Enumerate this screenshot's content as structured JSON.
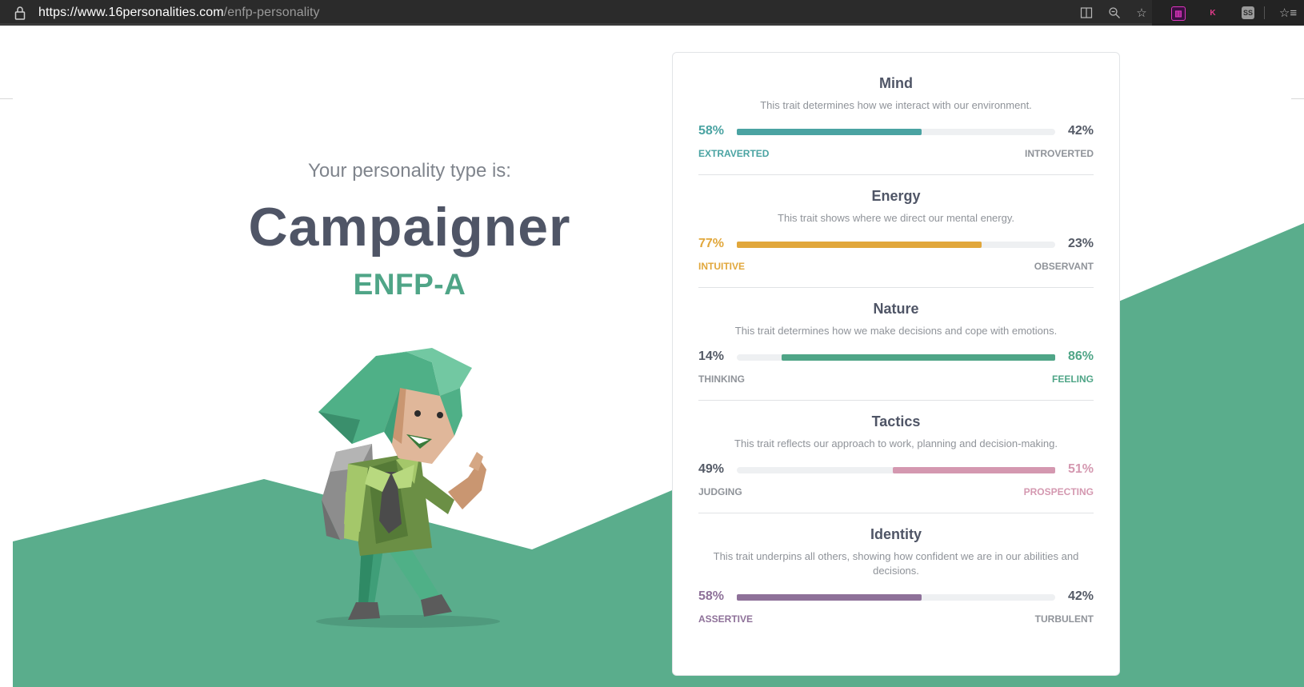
{
  "browser": {
    "url_domain": "https://www.16personalities.com",
    "url_path": "/enfp-personality",
    "icons": [
      "lock-icon",
      "reader-mode-icon",
      "zoom-icon",
      "favorite-star-icon",
      "extension-1-icon",
      "extension-k-icon",
      "extension-ss-icon",
      "favorites-bar-icon"
    ],
    "ext_k_label": "K",
    "ext_ss_label": "SS"
  },
  "hero": {
    "intro": "Your personality type is:",
    "type_name": "Campaigner",
    "type_code": "ENFP-A"
  },
  "colors": {
    "teal": "#4aa3a2",
    "yellow": "#e1a73b",
    "green": "#4fa587",
    "pink": "#d498b0",
    "purple": "#8e7199",
    "neutral_text": "#545a66",
    "label_neutral": "#8f9399",
    "hill": "#5aad8c"
  },
  "traits": [
    {
      "title": "Mind",
      "description": "This trait determines how we interact with our environment.",
      "left_pct": "58%",
      "right_pct": "42%",
      "left_label": "EXTRAVERTED",
      "right_label": "INTROVERTED",
      "value": 0.58,
      "dominant": "left",
      "color": "#4aa3a2"
    },
    {
      "title": "Energy",
      "description": "This trait shows where we direct our mental energy.",
      "left_pct": "77%",
      "right_pct": "23%",
      "left_label": "INTUITIVE",
      "right_label": "OBSERVANT",
      "value": 0.77,
      "dominant": "left",
      "color": "#e1a73b"
    },
    {
      "title": "Nature",
      "description": "This trait determines how we make decisions and cope with emotions.",
      "left_pct": "14%",
      "right_pct": "86%",
      "left_label": "THINKING",
      "right_label": "FEELING",
      "value": 0.86,
      "dominant": "right",
      "color": "#4fa587"
    },
    {
      "title": "Tactics",
      "description": "This trait reflects our approach to work, planning and decision-making.",
      "left_pct": "49%",
      "right_pct": "51%",
      "left_label": "JUDGING",
      "right_label": "PROSPECTING",
      "value": 0.51,
      "dominant": "right",
      "color": "#d498b0"
    },
    {
      "title": "Identity",
      "description": "This trait underpins all others, showing how confident we are in our abilities and decisions.",
      "left_pct": "58%",
      "right_pct": "42%",
      "left_label": "ASSERTIVE",
      "right_label": "TURBULENT",
      "value": 0.58,
      "dominant": "left",
      "color": "#8e7199"
    }
  ]
}
